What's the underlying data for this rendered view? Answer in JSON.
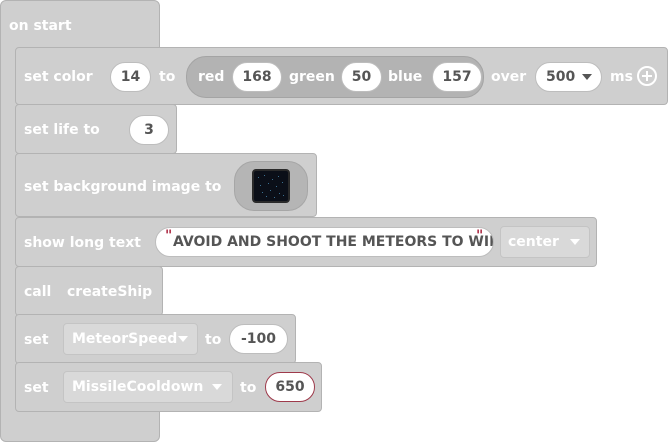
{
  "on_start": {
    "label": "on start"
  },
  "set_color": {
    "label": "set color",
    "color_value": "14",
    "to_label": "to",
    "red_label": "red",
    "red_value": "168",
    "green_label": "green",
    "green_value": "50",
    "blue_label": "blue",
    "blue_value": "157",
    "over_label": "over",
    "over_value": "500",
    "ms_label": "ms"
  },
  "set_life": {
    "label": "set life to",
    "value": "3"
  },
  "set_background": {
    "label": "set background image to"
  },
  "show_long_text": {
    "label": "show long text",
    "text": "AVOID AND SHOOT THE METEORS TO WIN",
    "position": "center"
  },
  "call_block": {
    "label": "call",
    "function": "createShip"
  },
  "set_meteor": {
    "label": "set",
    "variable": "MeteorSpeed",
    "to_label": "to",
    "value": "-100"
  },
  "set_missile": {
    "label": "set",
    "variable": "MissileCooldown",
    "to_label": "to",
    "value": "650"
  },
  "colors": {
    "block_fill": "#cfcfcf",
    "block_border": "#b3b3b3",
    "text": "#ffffff",
    "value_text": "#555555",
    "selected_border": "#9e3a4b",
    "quote": "#b0324a"
  },
  "icons": [
    "dropdown-arrow-icon",
    "add-parameter-icon",
    "image-thumbnail-icon"
  ]
}
